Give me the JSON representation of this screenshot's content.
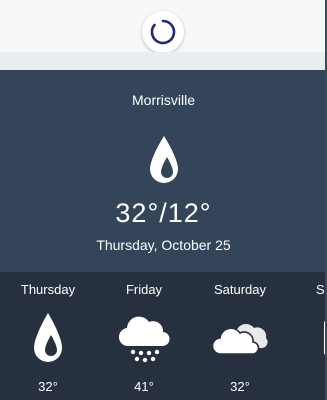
{
  "loading": {
    "icon": "loading-spinner-icon",
    "color": "#1f2a80"
  },
  "current": {
    "city": "Morrisville",
    "icon": "raindrop-icon",
    "temps": "32°/12°",
    "date": "Thursday,  October 25"
  },
  "forecast": [
    {
      "day": "Thursday",
      "icon": "raindrop-icon",
      "temp": "32°"
    },
    {
      "day": "Friday",
      "icon": "snow-cloud-icon",
      "temp": "41°"
    },
    {
      "day": "Saturday",
      "icon": "cloud-icon",
      "temp": "32°"
    },
    {
      "day": "Su",
      "icon": "partial-icon",
      "temp": ""
    }
  ],
  "colors": {
    "hero_bg": "#34455a",
    "forecast_bg": "#26303f",
    "text": "#ffffff"
  }
}
